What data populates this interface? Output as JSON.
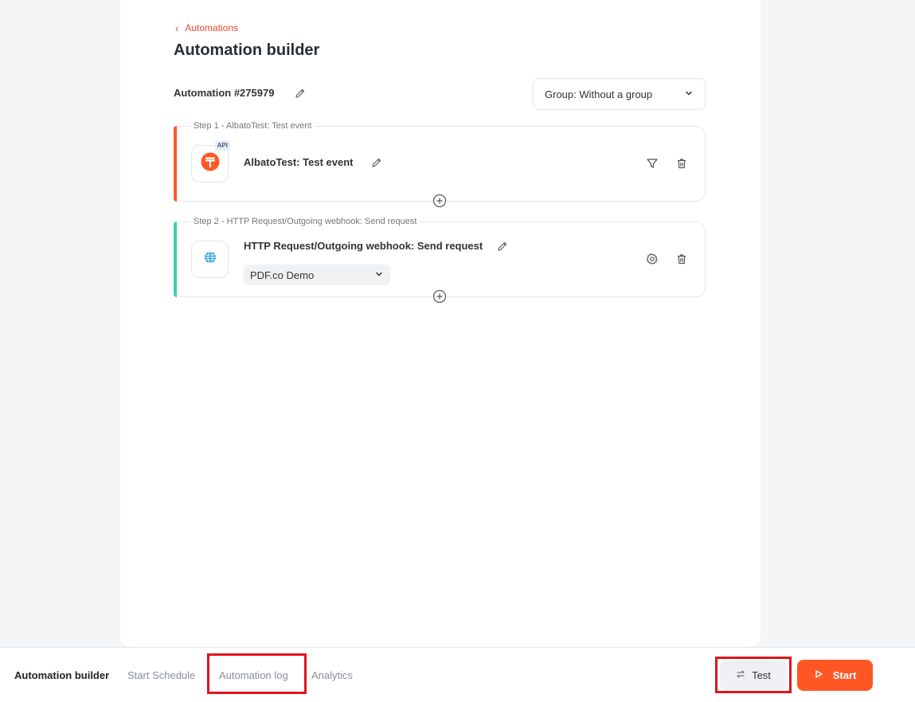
{
  "header": {
    "back_label": "Automations",
    "title": "Automation builder"
  },
  "automation": {
    "name": "Automation #275979",
    "group_select_value": "Group: Without a group"
  },
  "steps": [
    {
      "label": "Step 1 - AlbatoTest: Test event",
      "title": "AlbatoTest: Test event",
      "badge": "API",
      "app_icon": "albato-test-icon",
      "accent_color": "#ff5724"
    },
    {
      "label": "Step 2 - HTTP Request/Outgoing webhook: Send request",
      "title": "HTTP Request/Outgoing webhook: Send request",
      "connection_value": "PDF.co Demo",
      "app_icon": "globe-icon",
      "accent_color": "#3ecfb0"
    }
  ],
  "bottom_tabs": [
    {
      "label": "Automation builder",
      "active": true
    },
    {
      "label": "Start Schedule",
      "active": false
    },
    {
      "label": "Automation log",
      "active": false
    },
    {
      "label": "Analytics",
      "active": false
    }
  ],
  "actions": {
    "test_label": "Test",
    "start_label": "Start"
  },
  "colors": {
    "brand": "#ff5724",
    "link": "#e8482b",
    "highlight": "#e0141e"
  }
}
